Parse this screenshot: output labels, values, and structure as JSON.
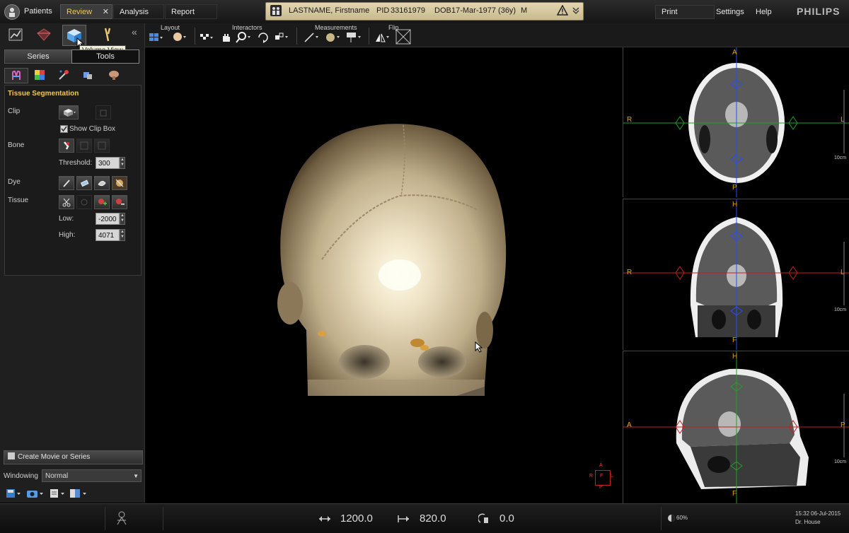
{
  "topbar": {
    "tabs": [
      {
        "label": "Patients"
      },
      {
        "label": "Review",
        "close": "✕"
      },
      {
        "label": "Analysis"
      },
      {
        "label": "Report"
      }
    ],
    "patient": {
      "name": "LASTNAME, Firstname",
      "pid_label": "PID",
      "pid": "33161979",
      "dob_label": "DOB",
      "dob": "17-Mar-1977 (36y)",
      "sex": "M"
    },
    "print": "Print",
    "settings": "Settings",
    "help": "Help",
    "brand": "PHILIPS"
  },
  "left": {
    "tooltip": "Volume View",
    "series_tab": "Series",
    "tools_tab": "Tools",
    "section_title": "Tissue Segmentation",
    "clip_label": "Clip",
    "show_clip_box": "Show Clip Box",
    "bone_label": "Bone",
    "threshold_label": "Threshold:",
    "threshold_value": "300",
    "dye_label": "Dye",
    "tissue_label": "Tissue",
    "low_label": "Low:",
    "low_value": "-2000",
    "high_label": "High:",
    "high_value": "4071",
    "create_movie": "Create Movie or Series",
    "windowing_label": "Windowing",
    "windowing_value": "Normal"
  },
  "toolbar": {
    "layout": "Layout",
    "interactors": "Interactors",
    "measurements": "Measurements",
    "flip": "Flip"
  },
  "viewports": {
    "axial": {
      "top": "A",
      "bottom": "P",
      "left": "R",
      "right": "L",
      "scale": "10cm"
    },
    "coronal": {
      "top": "H",
      "bottom": "F",
      "left": "R",
      "right": "L",
      "scale": "10cm"
    },
    "sagittal": {
      "top": "H",
      "bottom": "F",
      "left": "A",
      "right": "P",
      "scale": "10cm"
    },
    "orient_cube": {
      "top": "A",
      "left": "R",
      "center": "F",
      "right": "L",
      "bottom": "P"
    }
  },
  "bottom": {
    "window_width": "1200.0",
    "window_level": "820.0",
    "rotation": "0.0",
    "zoom": "60%",
    "time": "15:32",
    "date": "06-Jul-2015",
    "user": "Dr. House"
  },
  "colors": {
    "accent": "#f0c858",
    "orientation": "#e8a400",
    "crosshair_blue": "#2a4cff",
    "crosshair_green": "#1fa02a",
    "crosshair_red": "#c02020"
  }
}
